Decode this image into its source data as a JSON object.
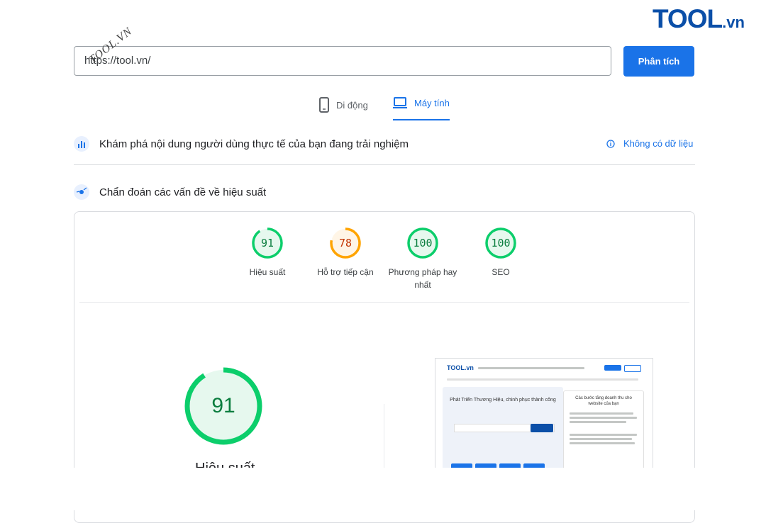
{
  "brand": {
    "logo_main": "TOOL",
    "logo_suffix": ".vn",
    "watermark": "TOOL.VN"
  },
  "search": {
    "url_value": "https://tool.vn/",
    "analyze_label": "Phân tích"
  },
  "device_tabs": [
    {
      "label": "Di động",
      "icon": "mobile-phone-icon",
      "active": false
    },
    {
      "label": "Máy tính",
      "icon": "laptop-icon",
      "active": true
    }
  ],
  "ux_section": {
    "title": "Khám phá nội dung người dùng thực tế của bạn đang trải nghiệm",
    "no_data": "Không có dữ liệu"
  },
  "diagnose_section": {
    "title": "Chẩn đoán các vấn đề về hiệu suất"
  },
  "scores": [
    {
      "value": "91",
      "label": "Hiệu suất",
      "color": "#0cce6b",
      "bg": "#e6f8ee"
    },
    {
      "value": "78",
      "label": "Hỗ trợ tiếp cận",
      "color": "#ffa400",
      "bg": "#fff5e6"
    },
    {
      "value": "100",
      "label": "Phương pháp hay nhất",
      "color": "#0cce6b",
      "bg": "#e6f8ee"
    },
    {
      "value": "100",
      "label": "SEO",
      "color": "#0cce6b",
      "bg": "#e6f8ee"
    }
  ],
  "performance": {
    "value": "91",
    "label": "Hiệu suất",
    "color": "#0cce6b"
  },
  "preview": {
    "logo": "TOOL.vn",
    "hero_title": "Phát Triển Thương Hiệu, chinh phục thành công",
    "side_title": "Các bước tăng doanh thu cho website của bạn"
  }
}
